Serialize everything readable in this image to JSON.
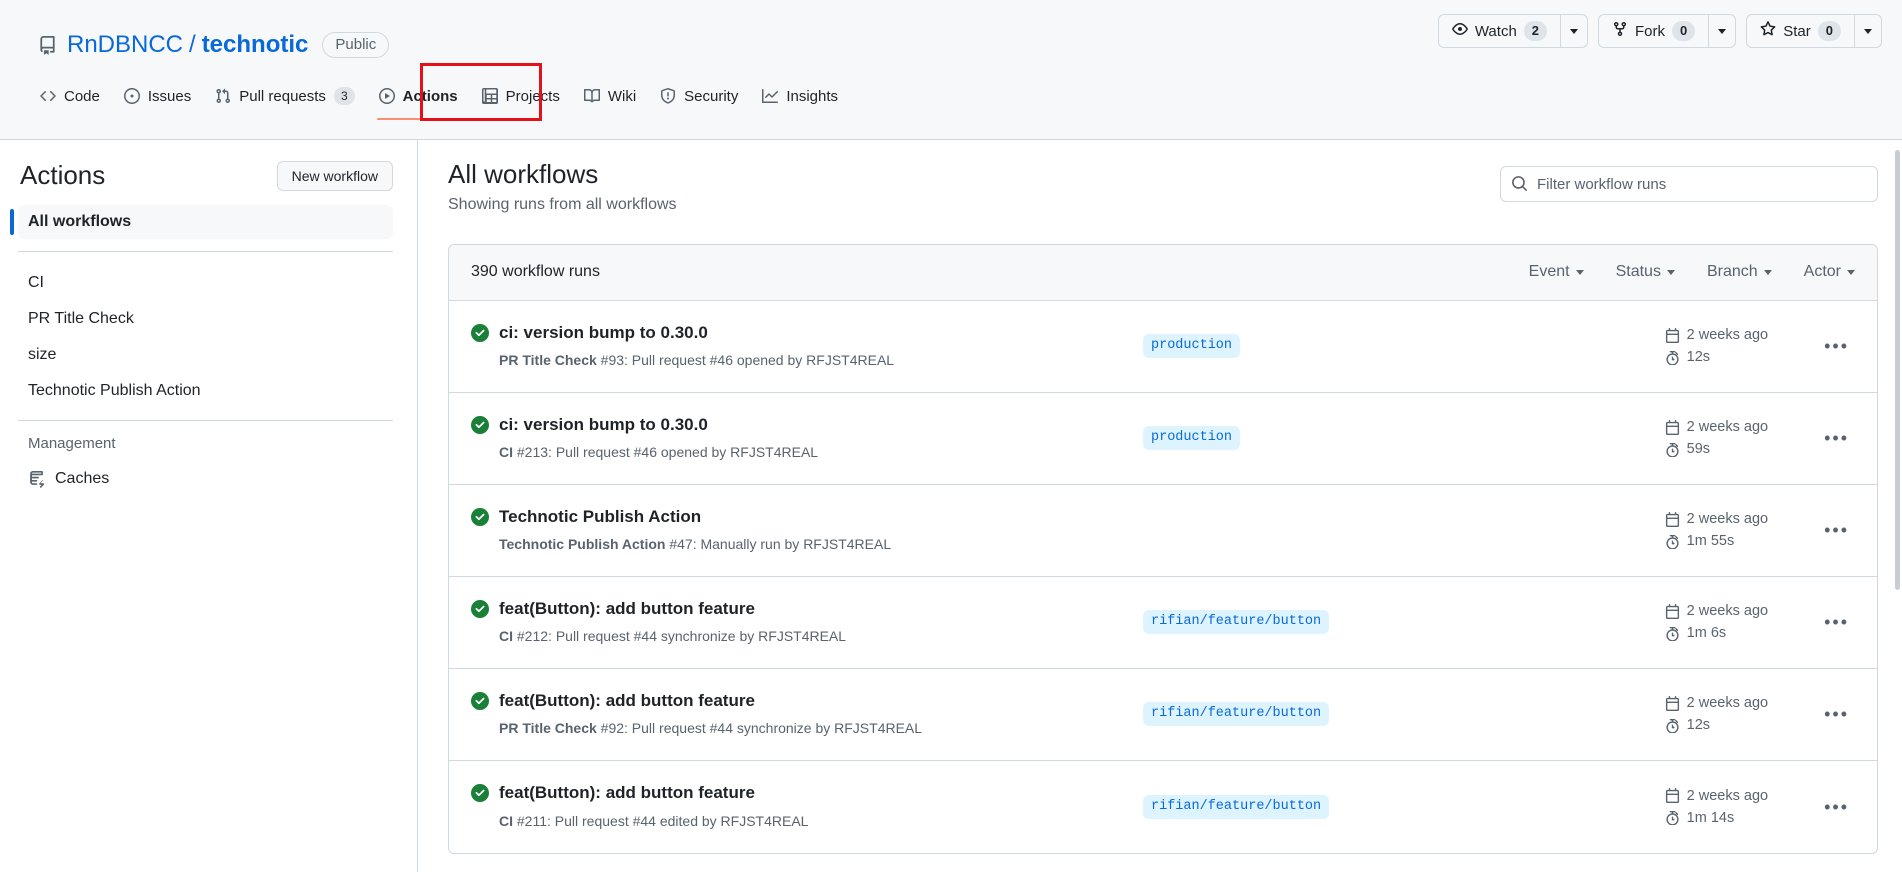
{
  "repo": {
    "owner": "RnDBNCC",
    "separator": "/",
    "name": "technotic",
    "visibility": "Public",
    "repo_icon": "repo-icon"
  },
  "repo_actions": {
    "watch": {
      "label": "Watch",
      "count": "2",
      "icon": "eye-icon"
    },
    "fork": {
      "label": "Fork",
      "count": "0",
      "icon": "fork-icon"
    },
    "star": {
      "label": "Star",
      "count": "0",
      "icon": "star-icon"
    }
  },
  "nav": {
    "items": [
      {
        "label": "Code",
        "icon": "code-icon",
        "selected": false,
        "count": null
      },
      {
        "label": "Issues",
        "icon": "issue-opened-icon",
        "selected": false,
        "count": null
      },
      {
        "label": "Pull requests",
        "icon": "git-pull-request-icon",
        "selected": false,
        "count": "3"
      },
      {
        "label": "Actions",
        "icon": "play-icon",
        "selected": true,
        "count": null
      },
      {
        "label": "Projects",
        "icon": "table-icon",
        "selected": false,
        "count": null
      },
      {
        "label": "Wiki",
        "icon": "book-icon",
        "selected": false,
        "count": null
      },
      {
        "label": "Security",
        "icon": "shield-icon",
        "selected": false,
        "count": null
      },
      {
        "label": "Insights",
        "icon": "graph-icon",
        "selected": false,
        "count": null
      }
    ],
    "highlight": {
      "target": "Actions",
      "color": "#e5111a"
    }
  },
  "sidebar": {
    "title": "Actions",
    "new_workflow_label": "New workflow",
    "all_workflows": "All workflows",
    "workflows": [
      {
        "label": "CI"
      },
      {
        "label": "PR Title Check"
      },
      {
        "label": "size"
      },
      {
        "label": "Technotic Publish Action"
      }
    ],
    "management_label": "Management",
    "management_items": [
      {
        "label": "Caches",
        "icon": "cache-icon"
      }
    ]
  },
  "main": {
    "title": "All workflows",
    "subtitle": "Showing runs from all workflows",
    "search": {
      "placeholder": "Filter workflow runs",
      "value": "",
      "icon": "search-icon"
    },
    "runs_count_label": "390 workflow runs",
    "filters": [
      {
        "label": "Event"
      },
      {
        "label": "Status"
      },
      {
        "label": "Branch"
      },
      {
        "label": "Actor"
      }
    ],
    "runs": [
      {
        "status": "success",
        "title": "ci: version bump to 0.30.0",
        "workflow": "PR Title Check",
        "detail": "#93: Pull request #46 opened by RFJST4REAL",
        "branch": "production",
        "time_ago": "2 weeks ago",
        "duration": "12s"
      },
      {
        "status": "success",
        "title": "ci: version bump to 0.30.0",
        "workflow": "CI",
        "detail": "#213: Pull request #46 opened by RFJST4REAL",
        "branch": "production",
        "time_ago": "2 weeks ago",
        "duration": "59s"
      },
      {
        "status": "success",
        "title": "Technotic Publish Action",
        "workflow": "Technotic Publish Action",
        "detail": "#47: Manually run by RFJST4REAL",
        "branch": "",
        "time_ago": "2 weeks ago",
        "duration": "1m 55s"
      },
      {
        "status": "success",
        "title": "feat(Button): add button feature",
        "workflow": "CI",
        "detail": "#212: Pull request #44 synchronize by RFJST4REAL",
        "branch": "rifian/feature/button",
        "time_ago": "2 weeks ago",
        "duration": "1m 6s"
      },
      {
        "status": "success",
        "title": "feat(Button): add button feature",
        "workflow": "PR Title Check",
        "detail": "#92: Pull request #44 synchronize by RFJST4REAL",
        "branch": "rifian/feature/button",
        "time_ago": "2 weeks ago",
        "duration": "12s"
      },
      {
        "status": "success",
        "title": "feat(Button): add button feature",
        "workflow": "CI",
        "detail": "#211: Pull request #44 edited by RFJST4REAL",
        "branch": "rifian/feature/button",
        "time_ago": "2 weeks ago",
        "duration": "1m 14s"
      }
    ],
    "row_menu_label": "•••"
  },
  "colors": {
    "accent": "#0969da",
    "success": "#1a7f37",
    "border": "#d1d9e0",
    "muted": "#59636e",
    "tab_indicator": "#fd8c73",
    "highlight": "#e5111a",
    "branch_bg": "#ddf4ff"
  }
}
